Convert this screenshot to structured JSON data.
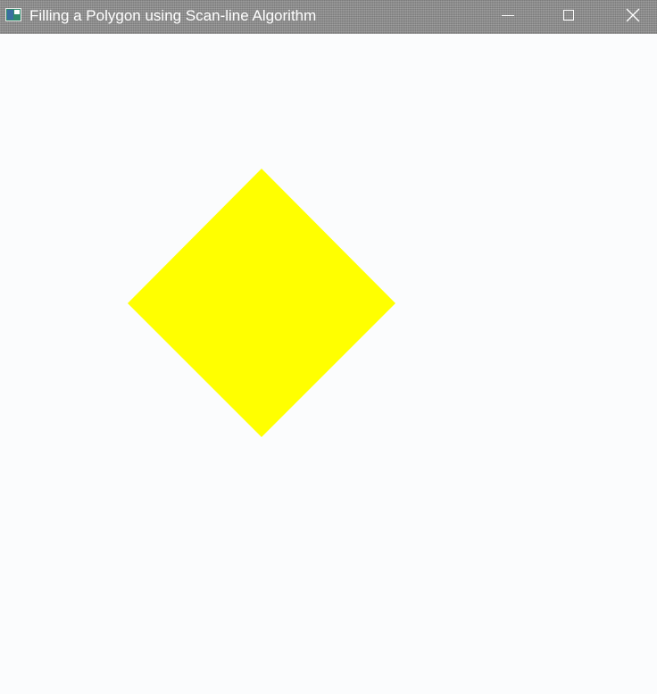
{
  "window": {
    "title": "Filling a Polygon using Scan-line Algorithm",
    "controls": {
      "minimize_icon": "minimize-icon",
      "maximize_icon": "maximize-icon",
      "close_icon": "close-icon"
    }
  },
  "canvas": {
    "background": "#fbfcfd",
    "polygon": {
      "shape": "diamond",
      "fill_color": "#ffff00"
    }
  }
}
